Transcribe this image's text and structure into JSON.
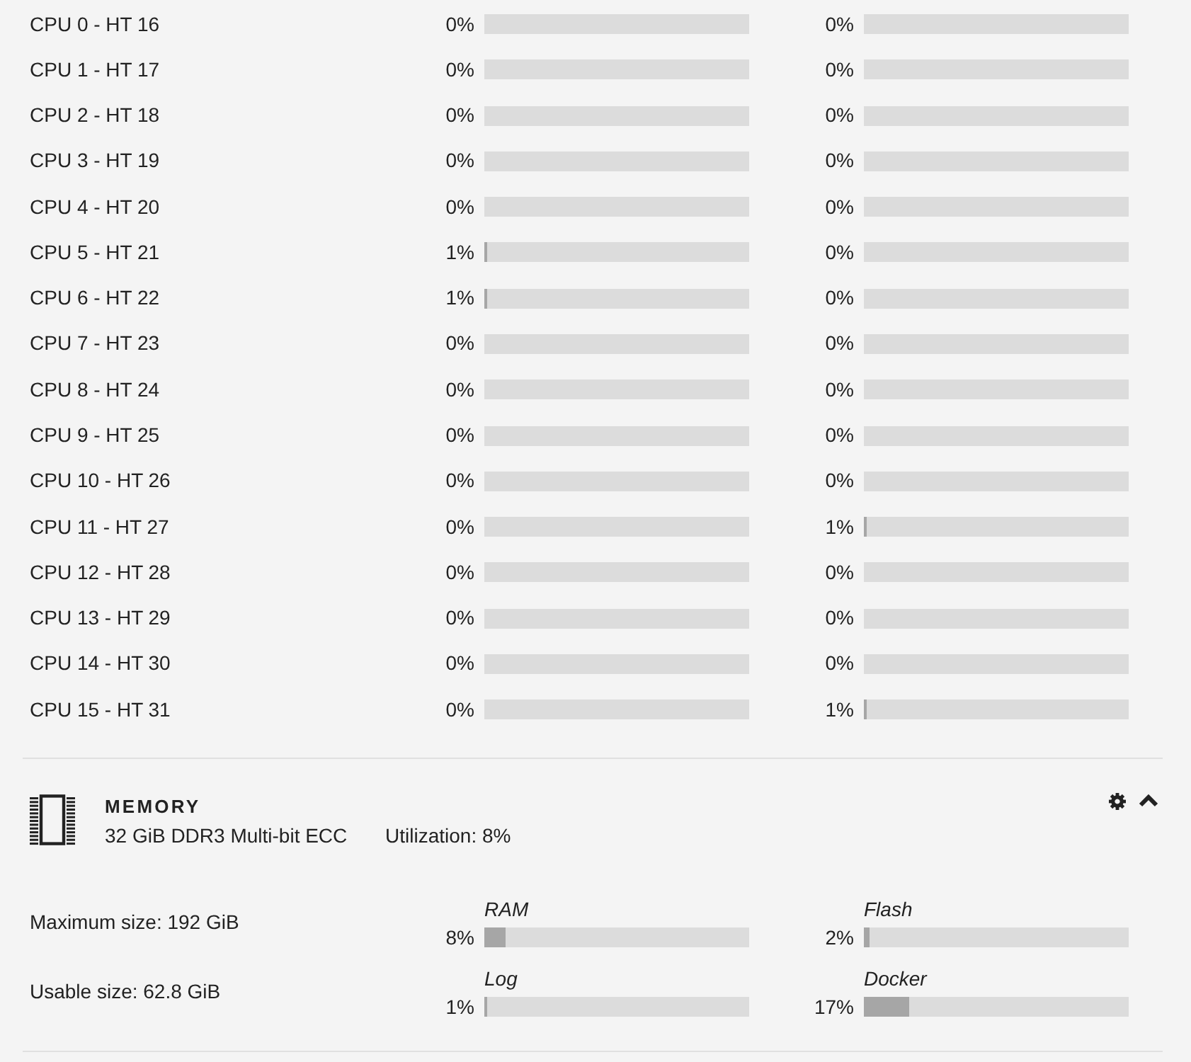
{
  "cpu_rows": [
    {
      "label": "CPU 0 - HT 16",
      "threads": [
        {
          "reading": "0%"
        },
        {
          "reading": "0%"
        }
      ]
    },
    {
      "label": "CPU 1 - HT 17",
      "threads": [
        {
          "reading": "0%"
        },
        {
          "reading": "0%"
        }
      ]
    },
    {
      "label": "CPU 2 - HT 18",
      "threads": [
        {
          "reading": "0%"
        },
        {
          "reading": "0%"
        }
      ]
    },
    {
      "label": "CPU 3 - HT 19",
      "threads": [
        {
          "reading": "0%"
        },
        {
          "reading": "0%"
        }
      ]
    },
    {
      "label": "CPU 4 - HT 20",
      "threads": [
        {
          "reading": "0%"
        },
        {
          "reading": "0%"
        }
      ]
    },
    {
      "label": "CPU 5 - HT 21",
      "threads": [
        {
          "reading": "1%",
          "level": 0.01
        },
        {
          "reading": "0%"
        }
      ]
    },
    {
      "label": "CPU 6 - HT 22",
      "threads": [
        {
          "reading": "1%",
          "level": 0.01
        },
        {
          "reading": "0%"
        }
      ]
    },
    {
      "label": "CPU 7 - HT 23",
      "threads": [
        {
          "reading": "0%"
        },
        {
          "reading": "0%"
        }
      ]
    },
    {
      "label": "CPU 8 - HT 24",
      "threads": [
        {
          "reading": "0%"
        },
        {
          "reading": "0%"
        }
      ]
    },
    {
      "label": "CPU 9 - HT 25",
      "threads": [
        {
          "reading": "0%"
        },
        {
          "reading": "0%"
        }
      ]
    },
    {
      "label": "CPU 10 - HT 26",
      "threads": [
        {
          "reading": "0%"
        },
        {
          "reading": "0%"
        }
      ]
    },
    {
      "label": "CPU 11 - HT 27",
      "threads": [
        {
          "reading": "0%"
        },
        {
          "reading": "1%",
          "level": 0.01
        }
      ]
    },
    {
      "label": "CPU 12 - HT 28",
      "threads": [
        {
          "reading": "0%"
        },
        {
          "reading": "0%"
        }
      ]
    },
    {
      "label": "CPU 13 - HT 29",
      "threads": [
        {
          "reading": "0%"
        },
        {
          "reading": "0%"
        }
      ]
    },
    {
      "label": "CPU 14 - HT 30",
      "threads": [
        {
          "reading": "0%"
        },
        {
          "reading": "0%"
        }
      ]
    },
    {
      "label": "CPU 15 - HT 31",
      "threads": [
        {
          "reading": "0%"
        },
        {
          "reading": "1%",
          "level": 0.01
        }
      ]
    }
  ],
  "memory": {
    "title": "MEMORY",
    "description": "32 GiB DDR3 Multi-bit ECC",
    "utilization": "Utilization: 8%",
    "expanded": true,
    "rows": [
      {
        "text": "Maximum size: 192 GiB",
        "meters": [
          {
            "label": "RAM",
            "reading": "8%",
            "level": 0.08
          },
          {
            "label": "Flash",
            "reading": "2%",
            "level": 0.02
          }
        ]
      },
      {
        "text": "Usable size: 62.8 GiB",
        "meters": [
          {
            "label": "Log",
            "reading": "1%",
            "level": 0.01
          },
          {
            "label": "Docker",
            "reading": "17%",
            "level": 0.17
          }
        ]
      }
    ]
  }
}
